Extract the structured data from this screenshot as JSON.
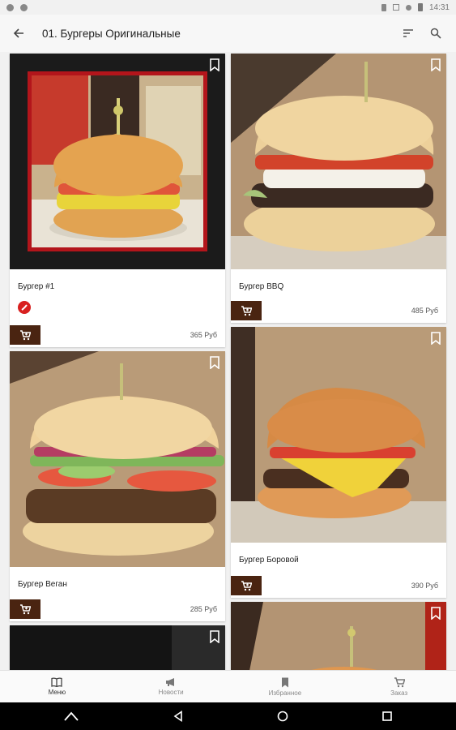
{
  "status_bar": {
    "time": "14:31"
  },
  "toolbar": {
    "title": "01. Бургеры Оригинальные"
  },
  "products": [
    {
      "name": "Бургер #1",
      "price": "365 Руб"
    },
    {
      "name": "Бургер BBQ",
      "price": "485 Руб"
    },
    {
      "name": "Бургер Веган",
      "price": "285 Руб"
    },
    {
      "name": "Бургер Боровой",
      "price": "390 Руб"
    }
  ],
  "tabs": [
    {
      "label": "Меню",
      "icon": "book-icon"
    },
    {
      "label": "Новости",
      "icon": "megaphone-icon"
    },
    {
      "label": "Избранное",
      "icon": "bookmark-icon"
    },
    {
      "label": "Заказ",
      "icon": "cart-icon"
    }
  ],
  "colors": {
    "accent": "#4a2411",
    "badge": "#d8201f",
    "frame_red": "#b3151b"
  }
}
